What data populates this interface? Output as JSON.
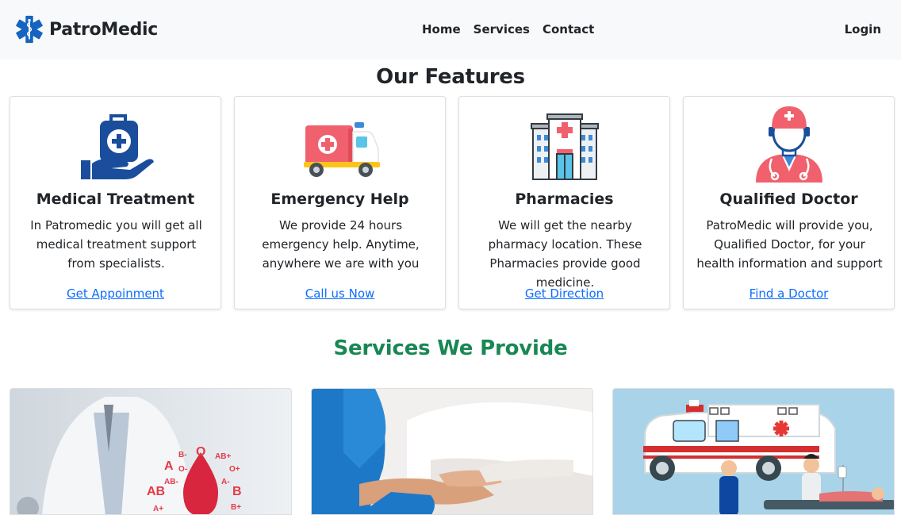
{
  "nav": {
    "brand": "PatroMedic",
    "links": [
      "Home",
      "Services",
      "Contact"
    ],
    "login": "Login"
  },
  "features": {
    "title": "Our Features",
    "cards": [
      {
        "icon": "medical-bag-hand-icon",
        "title": "Medical Treatment",
        "text": "In Patromedic you will get all medical treatment support from specialists.",
        "link": "Get Appoinment"
      },
      {
        "icon": "ambulance-icon",
        "title": "Emergency Help",
        "text": "We provide 24 hours emergency help. Anytime, anywhere we are with you",
        "link": "Call us Now"
      },
      {
        "icon": "hospital-building-icon",
        "title": "Pharmacies",
        "text": "We will get the nearby pharmacy location. These Pharmacies provide good medicine.",
        "link": "Get Direction"
      },
      {
        "icon": "doctor-avatar-icon",
        "title": "Qualified Doctor",
        "text": "PatroMedic will provide you, Qualified Doctor, for your health information and support",
        "link": "Find a Doctor"
      }
    ]
  },
  "services": {
    "title": "Services We Provide",
    "blood_labels": [
      "A",
      "B-",
      "O",
      "AB+",
      "O-",
      "O+",
      "AB-",
      "A-",
      "AB",
      "B",
      "B+",
      "A+"
    ]
  },
  "colors": {
    "navbar_bg": "#f8f9fa",
    "link": "#0d6efd",
    "services_title": "#198754",
    "icon_blue": "#1a4e9c",
    "icon_red": "#f0616d"
  }
}
